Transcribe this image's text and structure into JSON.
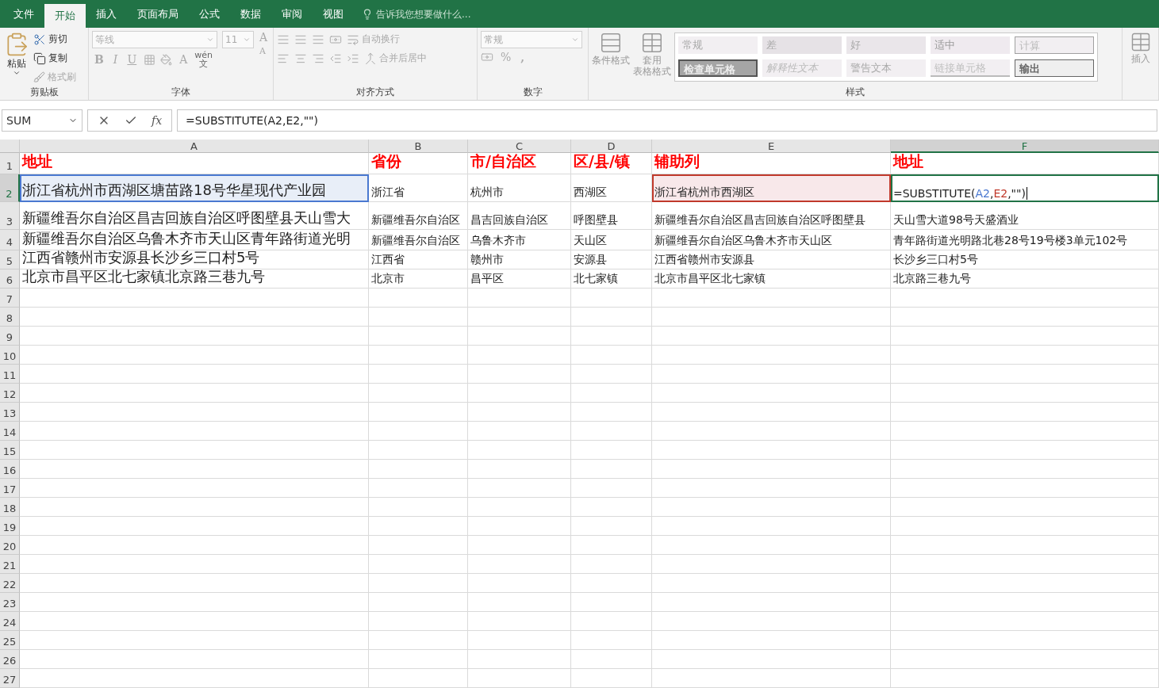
{
  "menu_tabs": [
    {
      "label": "文件",
      "selected": false
    },
    {
      "label": "开始",
      "selected": true
    },
    {
      "label": "插入",
      "selected": false
    },
    {
      "label": "页面布局",
      "selected": false
    },
    {
      "label": "公式",
      "selected": false
    },
    {
      "label": "数据",
      "selected": false
    },
    {
      "label": "审阅",
      "selected": false
    },
    {
      "label": "视图",
      "selected": false
    }
  ],
  "tell_me": {
    "placeholder": "告诉我您想要做什么..."
  },
  "clipboard": {
    "paste": "粘贴",
    "cut": "剪切",
    "copy": "复制",
    "format_painter": "格式刷",
    "group_label": "剪贴板"
  },
  "font": {
    "font_name": "等线",
    "font_size": "11",
    "bold": "B",
    "italic": "I",
    "underline": "U",
    "font_color": "A",
    "grow": "A",
    "shrink": "A",
    "phonetic_top": "wén",
    "phonetic_bottom": "文",
    "group_label": "字体"
  },
  "alignment": {
    "wrap_text": "自动换行",
    "merge_center": "合并后居中",
    "group_label": "对齐方式"
  },
  "number": {
    "format": "常规",
    "percent": "%",
    "comma": ",",
    "group_label": "数字"
  },
  "styles": {
    "conditional": "条件格式",
    "table_top": "套用",
    "table_bottom": "表格格式",
    "group_label": "样式",
    "gallery": [
      {
        "label": "常规",
        "kind": "normal"
      },
      {
        "label": "差",
        "kind": "bad"
      },
      {
        "label": "好",
        "kind": "good"
      },
      {
        "label": "适中",
        "kind": "neutral"
      },
      {
        "label": "计算",
        "kind": "calc"
      },
      {
        "label": "检查单元格",
        "kind": "check"
      },
      {
        "label": "解释性文本",
        "kind": "explanatory"
      },
      {
        "label": "警告文本",
        "kind": "warning"
      },
      {
        "label": "链接单元格",
        "kind": "linked"
      },
      {
        "label": "输出",
        "kind": "output"
      }
    ]
  },
  "cells_group": {
    "insert": "插入"
  },
  "formula_bar": {
    "name_box": "SUM",
    "function_symbol": "fx",
    "formula": "=SUBSTITUTE(A2,E2,\"\")"
  },
  "columns": [
    {
      "label": "A",
      "selected": false
    },
    {
      "label": "B",
      "selected": false
    },
    {
      "label": "C",
      "selected": false
    },
    {
      "label": "D",
      "selected": false
    },
    {
      "label": "E",
      "selected": false
    },
    {
      "label": "F",
      "selected": true
    }
  ],
  "rows": [
    {
      "number": "1",
      "selected": false,
      "cells": [
        {
          "text": "地址",
          "kind": "header"
        },
        {
          "text": "省份",
          "kind": "header"
        },
        {
          "text": "市/自治区",
          "kind": "header"
        },
        {
          "text": "区/县/镇",
          "kind": "header"
        },
        {
          "text": "辅助列",
          "kind": "header"
        },
        {
          "text": "地址",
          "kind": "header"
        }
      ]
    },
    {
      "number": "2",
      "selected": true,
      "cells": [
        {
          "text": "浙江省杭州市西湖区塘苗路18号华星现代产业园",
          "kind": "ref_blue"
        },
        {
          "text": "浙江省",
          "kind": "plain"
        },
        {
          "text": "杭州市",
          "kind": "plain"
        },
        {
          "text": "西湖区",
          "kind": "plain"
        },
        {
          "text": "浙江省杭州市西湖区",
          "kind": "ref_red"
        },
        {
          "kind": "editing",
          "segments": [
            {
              "text": "=SUBSTITUTE("
            },
            {
              "text": "A2",
              "color": "#4a78d0"
            },
            {
              "text": ","
            },
            {
              "text": "E2",
              "color": "#c0392b"
            },
            {
              "text": ",\"\")"
            }
          ]
        }
      ]
    },
    {
      "number": "3",
      "selected": false,
      "cells": [
        {
          "text": "新疆维吾尔自治区昌吉回族自治区呼图壁县天山雪大",
          "kind": "plain"
        },
        {
          "text": "新疆维吾尔自治区",
          "kind": "plain"
        },
        {
          "text": "昌吉回族自治区",
          "kind": "plain"
        },
        {
          "text": "呼图壁县",
          "kind": "plain"
        },
        {
          "text": "新疆维吾尔自治区昌吉回族自治区呼图壁县",
          "kind": "plain"
        },
        {
          "text": "天山雪大道98号天盛酒业",
          "kind": "plain"
        }
      ]
    },
    {
      "number": "4",
      "selected": false,
      "cells": [
        {
          "text": "新疆维吾尔自治区乌鲁木齐市天山区青年路街道光明",
          "kind": "plain"
        },
        {
          "text": "新疆维吾尔自治区",
          "kind": "plain"
        },
        {
          "text": "乌鲁木齐市",
          "kind": "plain"
        },
        {
          "text": "天山区",
          "kind": "plain"
        },
        {
          "text": "新疆维吾尔自治区乌鲁木齐市天山区",
          "kind": "plain"
        },
        {
          "text": "青年路街道光明路北巷28号19号楼3单元102号",
          "kind": "plain"
        }
      ]
    },
    {
      "number": "5",
      "selected": false,
      "cells": [
        {
          "text": "江西省赣州市安源县长沙乡三口村5号",
          "kind": "plain"
        },
        {
          "text": "江西省",
          "kind": "plain"
        },
        {
          "text": "赣州市",
          "kind": "plain"
        },
        {
          "text": "安源县",
          "kind": "plain"
        },
        {
          "text": "江西省赣州市安源县",
          "kind": "plain"
        },
        {
          "text": "长沙乡三口村5号",
          "kind": "plain"
        }
      ]
    },
    {
      "number": "6",
      "selected": false,
      "cells": [
        {
          "text": "北京市昌平区北七家镇北京路三巷九号",
          "kind": "plain"
        },
        {
          "text": "北京市",
          "kind": "plain"
        },
        {
          "text": "昌平区",
          "kind": "plain"
        },
        {
          "text": "北七家镇",
          "kind": "plain"
        },
        {
          "text": "北京市昌平区北七家镇",
          "kind": "plain"
        },
        {
          "text": "北京路三巷九号",
          "kind": "plain"
        }
      ]
    },
    {
      "number": "7",
      "selected": false,
      "cells": []
    },
    {
      "number": "8",
      "selected": false,
      "cells": []
    },
    {
      "number": "9",
      "selected": false,
      "cells": []
    },
    {
      "number": "10",
      "selected": false,
      "cells": []
    },
    {
      "number": "11",
      "selected": false,
      "cells": []
    },
    {
      "number": "12",
      "selected": false,
      "cells": []
    },
    {
      "number": "13",
      "selected": false,
      "cells": []
    },
    {
      "number": "14",
      "selected": false,
      "cells": []
    },
    {
      "number": "15",
      "selected": false,
      "cells": []
    },
    {
      "number": "16",
      "selected": false,
      "cells": []
    },
    {
      "number": "17",
      "selected": false,
      "cells": []
    },
    {
      "number": "18",
      "selected": false,
      "cells": []
    },
    {
      "number": "19",
      "selected": false,
      "cells": []
    },
    {
      "number": "20",
      "selected": false,
      "cells": []
    },
    {
      "number": "21",
      "selected": false,
      "cells": []
    },
    {
      "number": "22",
      "selected": false,
      "cells": []
    },
    {
      "number": "23",
      "selected": false,
      "cells": []
    },
    {
      "number": "24",
      "selected": false,
      "cells": []
    },
    {
      "number": "25",
      "selected": false,
      "cells": []
    },
    {
      "number": "26",
      "selected": false,
      "cells": []
    },
    {
      "number": "27",
      "selected": false,
      "cells": []
    }
  ]
}
